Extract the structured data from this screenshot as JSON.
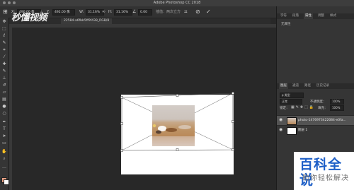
{
  "window": {
    "title": "Adobe Photoshop CC 2018"
  },
  "options_bar": {
    "x_value": "490.00 像",
    "y_value": "492.00 像",
    "w_value": "31.16%",
    "h_value": "31.16%",
    "angle_value": "0.00",
    "interpolation_label": "插值：两次立方"
  },
  "document_tab": {
    "name": "22584-a6fbb5ff9f438_RGB/8"
  },
  "panel": {
    "top_tabs": [
      "字符",
      "段落",
      "属性",
      "调整",
      "样式"
    ],
    "active_top_tab": "属性",
    "no_properties_text": "无属性",
    "layer_tabs": [
      "图层",
      "通道",
      "路径",
      "历史记录"
    ],
    "blend_mode": "正常",
    "opacity_label": "不透明度：",
    "opacity_value": "100%",
    "lock_label": "锁定：",
    "fill_label": "填充：",
    "fill_value": "100%",
    "layers": [
      {
        "name": "photo-1476973422084-e0fa..."
      },
      {
        "name": "图层 1"
      }
    ]
  },
  "watermarks": {
    "corner_logo": "秒懂视频",
    "baike_title": "百科全说",
    "baike_subtitle": "助你轻松解决"
  },
  "colors": {
    "foreground": "#e8a184",
    "background": "#ffffff",
    "accent": "#1e5fc7"
  },
  "icons": {
    "options": [
      "link-icon",
      "angle-icon",
      "warp-icon",
      "cancel-icon",
      "commit-icon"
    ],
    "tools": [
      "move-icon",
      "marquee-icon",
      "lasso-icon",
      "quick-select-icon",
      "crop-icon",
      "eyedropper-icon",
      "healing-icon",
      "brush-icon",
      "stamp-icon",
      "history-brush-icon",
      "eraser-icon",
      "gradient-icon",
      "blur-icon",
      "dodge-icon",
      "pen-icon",
      "type-icon",
      "path-select-icon",
      "shape-icon",
      "hand-icon",
      "zoom-icon"
    ]
  }
}
